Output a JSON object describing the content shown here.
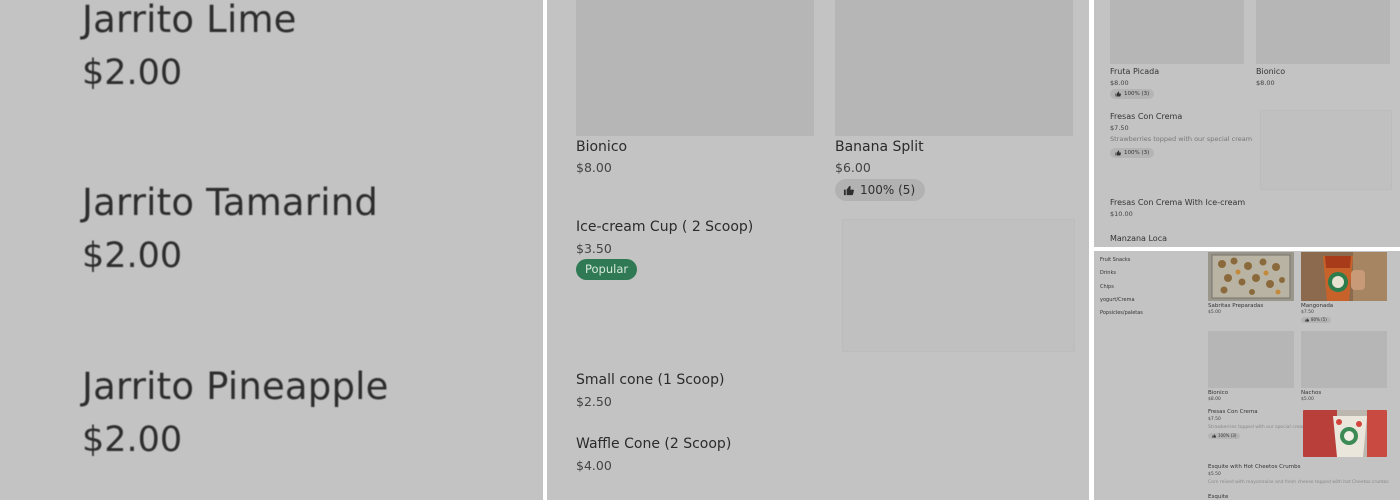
{
  "panel1": {
    "items": [
      {
        "name": "Jarrito Lime",
        "price": "$2.00"
      },
      {
        "name": "Jarrito Tamarind",
        "price": "$2.00"
      },
      {
        "name": "Jarrito Pineapple",
        "price": "$2.00"
      }
    ]
  },
  "panel2": {
    "bionico": {
      "name": "Bionico",
      "price": "$8.00"
    },
    "banana_split": {
      "name": "Banana Split",
      "price": "$6.00",
      "rating": "100% (5)"
    },
    "icecream_cup": {
      "name": "Ice-cream Cup ( 2 Scoop)",
      "price": "$3.50",
      "badge": "Popular"
    },
    "small_cone": {
      "name": "Small cone (1 Scoop)",
      "price": "$2.50"
    },
    "waffle_cone": {
      "name": "Waffle Cone (2 Scoop)",
      "price": "$4.00"
    }
  },
  "panel3": {
    "fruta_picada": {
      "name": "Fruta Picada",
      "price": "$8.00",
      "rating": "100% (3)"
    },
    "bionico": {
      "name": "Bionico",
      "price": "$8.00"
    },
    "fresas_con_crema": {
      "name": "Fresas Con Crema",
      "price": "$7.50",
      "description": "Strawberries topped with our special cream",
      "rating": "100% (3)"
    },
    "fresas_icecream": {
      "name": "Fresas Con Crema With Ice-cream",
      "price": "$10.00"
    },
    "manzana_loca": {
      "name": "Manzana Loca"
    }
  },
  "panel4": {
    "categories": [
      "Fruit Snacks",
      "Drinks",
      "Chips",
      "yogurt/Crema",
      "Popsicles/paletas"
    ],
    "sabritas": {
      "name": "Sabritas Preparadas",
      "price": "$5.00"
    },
    "mangonada": {
      "name": "Mangonada",
      "price": "$7.50",
      "rating": "80% (5)"
    },
    "bionico": {
      "name": "Bionico",
      "price": "$8.00"
    },
    "nachos": {
      "name": "Nachos",
      "price": "$5.00"
    },
    "fresas_con_crema": {
      "name": "Fresas Con Crema",
      "price": "$7.50",
      "description": "Strawberries topped with our special cream",
      "rating": "100% (3)"
    },
    "esquite": {
      "name": "Esquite with Hot Cheetos Crumbs",
      "price": "$5.50",
      "description": "Corn mixed with mayonnaise and fresh cheese topped with hot Cheetos crumbs"
    },
    "esquite2": {
      "name": "Esquite"
    }
  },
  "colors": {
    "panel_bg": "#c3c3c3",
    "image_placeholder": "#b6b6b6",
    "popular_badge": "#2f7a54",
    "divider": "#ffffff"
  }
}
